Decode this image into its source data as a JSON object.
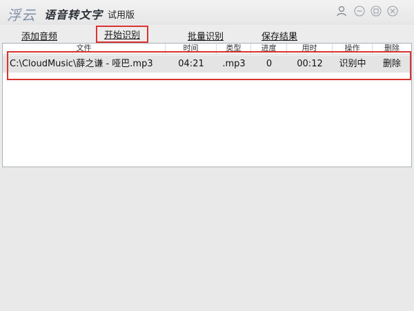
{
  "titlebar": {
    "logo": "浮云",
    "app_title": "语音转文字",
    "edition": "试用版"
  },
  "menu": {
    "add_audio": "添加音频",
    "start_recognition": "开始识别",
    "batch_recognition": "批量识别",
    "save_results": "保存结果"
  },
  "table": {
    "columns": [
      "文件",
      "时间",
      "类型",
      "进度",
      "用时",
      "操作",
      "删除"
    ],
    "rows": [
      {
        "file": "C:\\CloudMusic\\薛之谦 - 哑巴.mp3",
        "time": "04:21",
        "type": ".mp3",
        "progress": "0",
        "elapsed": "00:12",
        "action": "识别中",
        "delete": "删除"
      }
    ]
  },
  "colors": {
    "highlight": "#d9322f",
    "row_background": "#e4e4e4"
  }
}
